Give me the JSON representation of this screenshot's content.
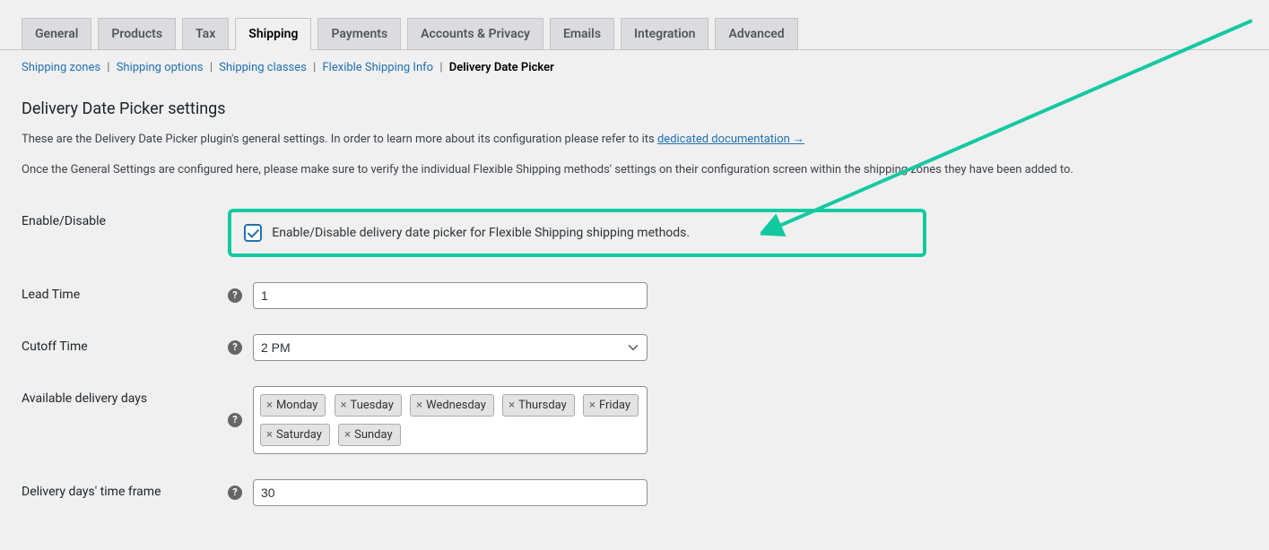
{
  "tabs": [
    {
      "label": "General"
    },
    {
      "label": "Products"
    },
    {
      "label": "Tax"
    },
    {
      "label": "Shipping",
      "active": true
    },
    {
      "label": "Payments"
    },
    {
      "label": "Accounts & Privacy"
    },
    {
      "label": "Emails"
    },
    {
      "label": "Integration"
    },
    {
      "label": "Advanced"
    }
  ],
  "subnav": [
    {
      "label": "Shipping zones"
    },
    {
      "label": "Shipping options"
    },
    {
      "label": "Shipping classes"
    },
    {
      "label": "Flexible Shipping Info"
    },
    {
      "label": "Delivery Date Picker",
      "current": true
    }
  ],
  "heading": "Delivery Date Picker settings",
  "intro_prefix": "These are the Delivery Date Picker plugin's general settings. In order to learn more about its configuration please refer to its ",
  "intro_link": "dedicated documentation →",
  "intro2": "Once the General Settings are configured here, please make sure to verify the individual Flexible Shipping methods' settings on their configuration screen within the shipping zones they have been added to.",
  "fields": {
    "enable": {
      "label": "Enable/Disable",
      "cb_label": "Enable/Disable delivery date picker for Flexible Shipping shipping methods."
    },
    "lead_time": {
      "label": "Lead Time",
      "value": "1"
    },
    "cutoff_time": {
      "label": "Cutoff Time",
      "value": "2 PM"
    },
    "available_days": {
      "label": "Available delivery days",
      "values": [
        "Monday",
        "Tuesday",
        "Wednesday",
        "Thursday",
        "Friday",
        "Saturday",
        "Sunday"
      ]
    },
    "time_frame": {
      "label": "Delivery days' time frame",
      "value": "30"
    }
  }
}
